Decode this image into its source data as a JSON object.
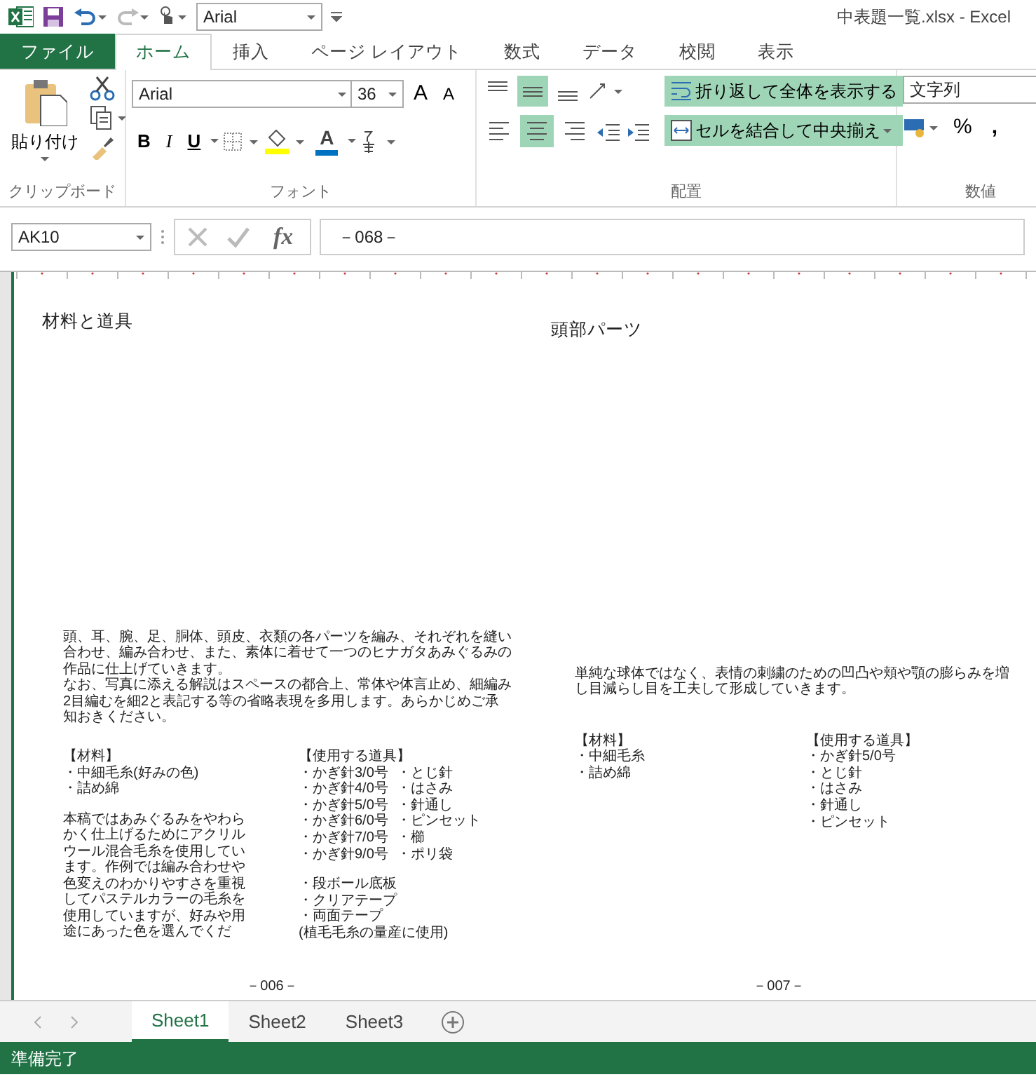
{
  "window": {
    "title": "中表題一覧.xlsx - Excel"
  },
  "quick_access": {
    "font": "Arial"
  },
  "ribbon_tabs": [
    {
      "label": "ファイル",
      "kind": "file",
      "selected": false
    },
    {
      "label": "ホーム",
      "kind": "tab",
      "selected": true
    },
    {
      "label": "挿入",
      "kind": "tab",
      "selected": false
    },
    {
      "label": "ページ レイアウト",
      "kind": "tab",
      "selected": false
    },
    {
      "label": "数式",
      "kind": "tab",
      "selected": false
    },
    {
      "label": "データ",
      "kind": "tab",
      "selected": false
    },
    {
      "label": "校閲",
      "kind": "tab",
      "selected": false
    },
    {
      "label": "表示",
      "kind": "tab",
      "selected": false
    }
  ],
  "ribbon": {
    "clipboard": {
      "paste": "貼り付け",
      "group": "クリップボード"
    },
    "font": {
      "name": "Arial",
      "size": "36",
      "grow": "A",
      "shrink": "A",
      "styles": [
        "B",
        "I",
        "U"
      ],
      "color_label": "A",
      "group": "フォント"
    },
    "alignment": {
      "vertical": [
        {
          "selected": false
        },
        {
          "selected": true
        },
        {
          "selected": false
        }
      ],
      "horizontal": [
        {
          "selected": false
        },
        {
          "selected": true
        },
        {
          "selected": false
        }
      ],
      "wrap": {
        "label": "折り返して全体を表示する",
        "selected": true
      },
      "merge": {
        "label": "セルを結合して中央揃え",
        "selected": true
      },
      "group": "配置"
    },
    "number": {
      "format": "文字列",
      "percent": "%",
      "comma": ",",
      "group": "数値"
    }
  },
  "formula_bar": {
    "cell": "AK10",
    "fx": "fx",
    "content": "－068－"
  },
  "pages": [
    {
      "heading": "材料と道具",
      "intro": [
        "頭、耳、腕、足、胴体、頭皮、衣類の各パーツを編み、それぞれを縫い合わせ、編み合わせ、また、素体に着せて一つのヒナガタあみぐるみの作品に仕上げていきます。",
        "なお、写真に添える解説はスペースの都合上、常体や体言止め、細編み2目編むを細2と表記する等の省略表現を多用します。あらかじめご承知おきください。"
      ],
      "materials": {
        "heading": "【材料】",
        "items": [
          "・中細毛糸(好みの色)",
          "・詰め綿"
        ],
        "note": "本稿ではあみぐるみをやわらかく仕上げるためにアクリルウール混合毛糸を使用しています。作例では編み合わせや色変えのわかりやすさを重視してパステルカラーの毛糸を使用していますが、好みや用途にあった色を選んでくだ"
      },
      "tools": {
        "heading": "【使用する道具】",
        "rows": [
          [
            "・かぎ針3/0号",
            "・とじ針"
          ],
          [
            "・かぎ針4/0号",
            "・はさみ"
          ],
          [
            "・かぎ針5/0号",
            "・針通し"
          ],
          [
            "・かぎ針6/0号",
            "・ピンセット"
          ],
          [
            "・かぎ針7/0号",
            "・櫛"
          ],
          [
            "・かぎ針9/0号",
            "・ポリ袋"
          ]
        ],
        "extra": [
          "・段ボール底板",
          "・クリアテープ",
          "・両面テープ",
          "(植毛毛糸の量産に使用)"
        ]
      },
      "footer": "－006－"
    },
    {
      "heading": "頭部パーツ",
      "intro": [
        "単純な球体ではなく、表情の刺繍のための凹凸や頬や顎の膨らみを増し目減らし目を工夫して形成していきます。"
      ],
      "materials": {
        "heading": "【材料】",
        "items": [
          "・中細毛糸",
          "・詰め綿"
        ]
      },
      "tools": {
        "heading": "【使用する道具】",
        "rows": [
          [
            "・かぎ針5/0号"
          ],
          [
            "・とじ針"
          ],
          [
            "・はさみ"
          ],
          [
            "・針通し"
          ],
          [
            "・ピンセット"
          ]
        ]
      },
      "footer": "－007－"
    }
  ],
  "sheet_tabs": [
    {
      "label": "Sheet1",
      "selected": true
    },
    {
      "label": "Sheet2",
      "selected": false
    },
    {
      "label": "Sheet3",
      "selected": false
    }
  ],
  "status": "準備完了"
}
